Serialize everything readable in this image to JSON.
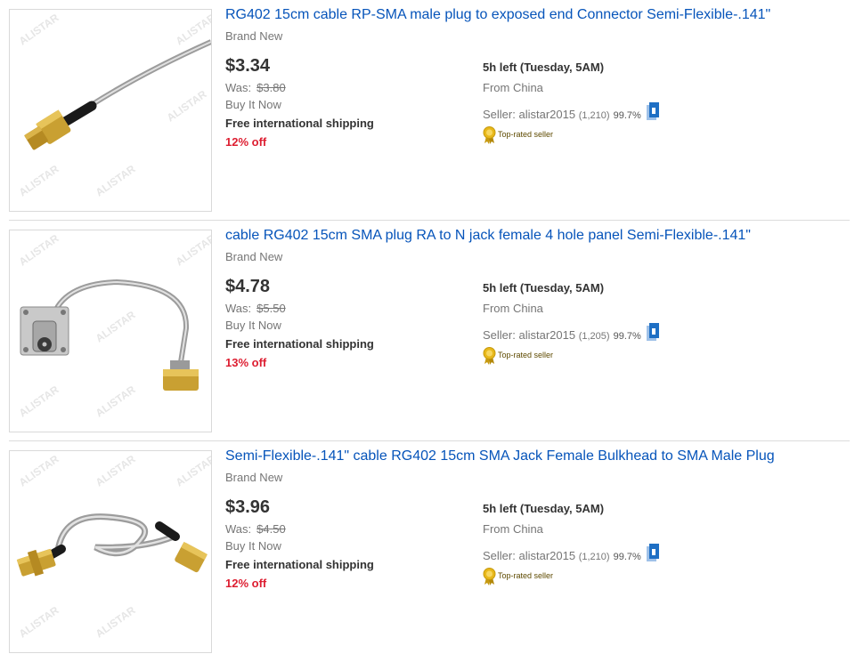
{
  "listings": [
    {
      "title": "RG402 15cm cable RP-SMA male plug to exposed end Connector Semi-Flexible-.141\"",
      "condition": "Brand New",
      "price": "$3.34",
      "was_label": "Was:",
      "was_price": "$3.80",
      "format": "Buy It Now",
      "shipping": "Free international shipping",
      "discount": "12% off",
      "time_left": "5h left (Tuesday, 5AM)",
      "location": "From China",
      "seller_label": "Seller:",
      "seller_name": "alistar2015",
      "feedback_count": "(1,210)",
      "feedback_pct": "99.7%",
      "top_rated": "Top-rated seller",
      "image_icon": "rp-sma-cable-exposed-end-image",
      "watermark": "ALISTAR"
    },
    {
      "title": "cable RG402 15cm SMA plug RA to N jack female 4 hole panel Semi-Flexible-.141\"",
      "condition": "Brand New",
      "price": "$4.78",
      "was_label": "Was:",
      "was_price": "$5.50",
      "format": "Buy It Now",
      "shipping": "Free international shipping",
      "discount": "13% off",
      "time_left": "5h left (Tuesday, 5AM)",
      "location": "From China",
      "seller_label": "Seller:",
      "seller_name": "alistar2015",
      "feedback_count": "(1,205)",
      "feedback_pct": "99.7%",
      "top_rated": "Top-rated seller",
      "image_icon": "sma-to-n-jack-panel-cable-image",
      "watermark": "ALISTAR"
    },
    {
      "title": "Semi-Flexible-.141\" cable RG402 15cm SMA Jack Female Bulkhead to SMA Male Plug",
      "condition": "Brand New",
      "price": "$3.96",
      "was_label": "Was:",
      "was_price": "$4.50",
      "format": "Buy It Now",
      "shipping": "Free international shipping",
      "discount": "12% off",
      "time_left": "5h left (Tuesday, 5AM)",
      "location": "From China",
      "seller_label": "Seller:",
      "seller_name": "alistar2015",
      "feedback_count": "(1,210)",
      "feedback_pct": "99.7%",
      "top_rated": "Top-rated seller",
      "image_icon": "sma-bulkhead-to-sma-male-cable-image",
      "watermark": "ALISTAR"
    }
  ],
  "colors": {
    "link": "#0654ba",
    "price": "#333333",
    "muted": "#767676",
    "discount": "#dd1e31",
    "store_icon": "#1e6fc4",
    "badge_gold": "#e8b81a"
  }
}
